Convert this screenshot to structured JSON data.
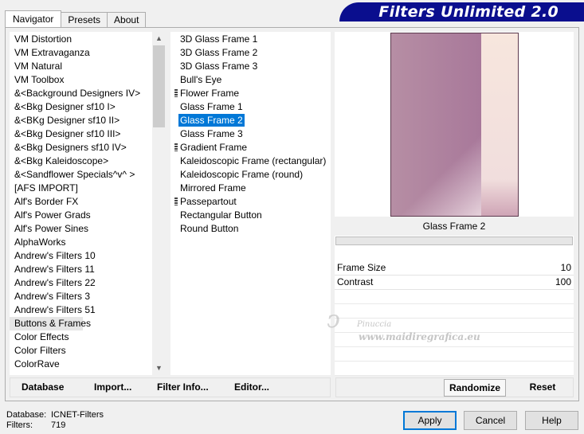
{
  "title": "Filters Unlimited 2.0",
  "tabs": [
    {
      "label": "Navigator",
      "active": true
    },
    {
      "label": "Presets",
      "active": false
    },
    {
      "label": "About",
      "active": false
    }
  ],
  "categories": [
    {
      "label": "VM Distortion"
    },
    {
      "label": "VM Extravaganza"
    },
    {
      "label": "VM Natural"
    },
    {
      "label": "VM Toolbox"
    },
    {
      "label": "&<Background Designers IV>"
    },
    {
      "label": "&<Bkg Designer sf10 I>"
    },
    {
      "label": "&<BKg Designer sf10 II>"
    },
    {
      "label": "&<Bkg Designer sf10 III>"
    },
    {
      "label": "&<Bkg Designers sf10 IV>"
    },
    {
      "label": "&<Bkg Kaleidoscope>"
    },
    {
      "label": "&<Sandflower Specials^v^ >"
    },
    {
      "label": "[AFS IMPORT]"
    },
    {
      "label": "Alf's Border FX"
    },
    {
      "label": "Alf's Power Grads"
    },
    {
      "label": "Alf's Power Sines"
    },
    {
      "label": "AlphaWorks"
    },
    {
      "label": "Andrew's Filters 10"
    },
    {
      "label": "Andrew's Filters 11"
    },
    {
      "label": "Andrew's Filters 22"
    },
    {
      "label": "Andrew's Filters 3"
    },
    {
      "label": "Andrew's Filters 51"
    },
    {
      "label": "Buttons & Frames",
      "selected": true
    },
    {
      "label": "Color Effects"
    },
    {
      "label": "Color Filters"
    },
    {
      "label": "ColorRave"
    }
  ],
  "filters": [
    {
      "label": "3D Glass Frame 1"
    },
    {
      "label": "3D Glass Frame 2"
    },
    {
      "label": "3D Glass Frame 3"
    },
    {
      "label": "Bull's Eye"
    },
    {
      "label": "Flower Frame",
      "marked": true
    },
    {
      "label": "Glass Frame 1"
    },
    {
      "label": "Glass Frame 2",
      "selected": true
    },
    {
      "label": "Glass Frame 3"
    },
    {
      "label": "Gradient Frame",
      "marked": true
    },
    {
      "label": "Kaleidoscopic Frame (rectangular)"
    },
    {
      "label": "Kaleidoscopic Frame (round)"
    },
    {
      "label": "Mirrored Frame"
    },
    {
      "label": "Passepartout",
      "marked": true
    },
    {
      "label": "Rectangular Button"
    },
    {
      "label": "Round Button"
    }
  ],
  "preview": {
    "filter_name": "Glass Frame 2"
  },
  "params": [
    {
      "label": "Frame Size",
      "value": "10"
    },
    {
      "label": "Contrast",
      "value": "100"
    }
  ],
  "watermark": {
    "line1": "Pinuccia",
    "line2": "www.maidiregrafica.eu"
  },
  "left_buttons": {
    "database": "Database",
    "import": "Import...",
    "filter_info": "Filter Info...",
    "editor": "Editor..."
  },
  "right_buttons": {
    "randomize": "Randomize",
    "reset": "Reset"
  },
  "status": {
    "database_key": "Database:",
    "database_value": "ICNET-Filters",
    "filters_key": "Filters:",
    "filters_value": "719"
  },
  "dialog_buttons": {
    "apply": "Apply",
    "cancel": "Cancel",
    "help": "Help"
  },
  "colors": {
    "title_bg": "#0a0e8e",
    "selection": "#0078d7"
  }
}
